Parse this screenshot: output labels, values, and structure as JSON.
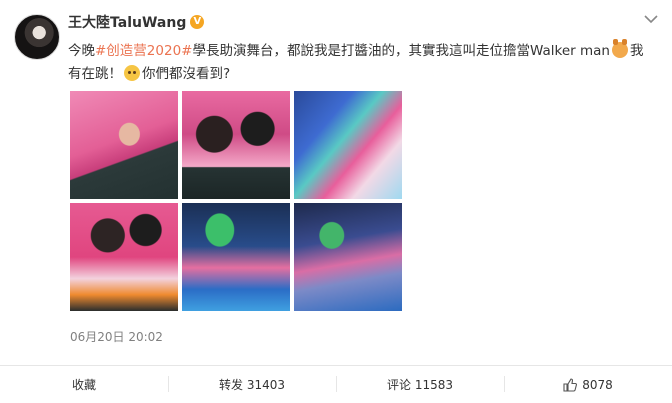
{
  "post": {
    "user_name": "王大陸TaluWang",
    "verified_badge": "V",
    "text_before_tag": "今晚",
    "hashtag": "#创造营2020#",
    "text_after_tag": "學長助演舞台，都說我是打醬油的，其實我這叫走位擔當Walker man",
    "text_mid": "我有在跳！",
    "text_end": "你們都沒看到?",
    "timestamp": "06月20日 20:02",
    "photos": [
      {
        "icon": "photo-stage-man-pink"
      },
      {
        "icon": "photo-two-performers"
      },
      {
        "icon": "photo-stage-blue"
      },
      {
        "icon": "photo-duet-hands"
      },
      {
        "icon": "photo-stage-green-bottle"
      },
      {
        "icon": "photo-stage-wide"
      }
    ]
  },
  "actions": {
    "favorite_label": "收藏",
    "repost_label": "转发 31403",
    "comment_label": "评论 11583",
    "like_count": "8078"
  },
  "colors": {
    "hashtag": "#eb7350",
    "verified": "#f5a623",
    "muted": "#808080"
  }
}
